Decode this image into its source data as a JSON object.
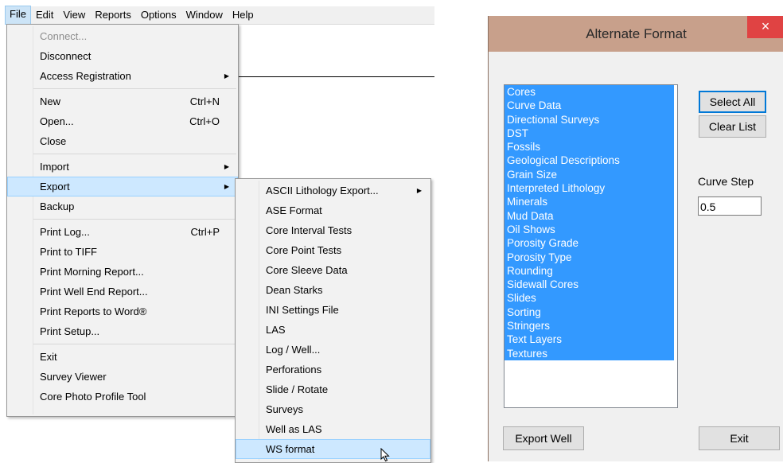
{
  "menubar": {
    "items": [
      "File",
      "Edit",
      "View",
      "Reports",
      "Options",
      "Window",
      "Help"
    ]
  },
  "file_menu": {
    "items": [
      {
        "label": "Connect...",
        "shortcut": "",
        "disabled": true
      },
      {
        "label": "Disconnect",
        "shortcut": ""
      },
      {
        "label": "Access Registration",
        "shortcut": "",
        "submenu": true
      },
      {
        "label": "New",
        "shortcut": "Ctrl+N"
      },
      {
        "label": "Open...",
        "shortcut": "Ctrl+O"
      },
      {
        "label": "Close",
        "shortcut": ""
      },
      {
        "label": "Import",
        "shortcut": "",
        "submenu": true
      },
      {
        "label": "Export",
        "shortcut": "",
        "submenu": true
      },
      {
        "label": "Backup",
        "shortcut": ""
      },
      {
        "label": "Print Log...",
        "shortcut": "Ctrl+P"
      },
      {
        "label": "Print to TIFF",
        "shortcut": ""
      },
      {
        "label": "Print Morning Report...",
        "shortcut": ""
      },
      {
        "label": "Print Well End Report...",
        "shortcut": ""
      },
      {
        "label": "Print Reports to Word®",
        "shortcut": ""
      },
      {
        "label": "Print Setup...",
        "shortcut": ""
      },
      {
        "label": "Exit",
        "shortcut": ""
      },
      {
        "label": "Survey Viewer",
        "shortcut": ""
      },
      {
        "label": "Core Photo Profile Tool",
        "shortcut": ""
      }
    ]
  },
  "export_menu": {
    "items": [
      "ASCII Lithology Export...",
      "ASE Format",
      "Core Interval Tests",
      "Core Point Tests",
      "Core Sleeve Data",
      "Dean Starks",
      "INI Settings File",
      "LAS",
      "Log / Well...",
      "Perforations",
      "Slide / Rotate",
      "Surveys",
      "Well as LAS",
      "WS format"
    ]
  },
  "dialog": {
    "title": "Alternate Format",
    "close": "×",
    "list_items": [
      "Cores",
      "Curve Data",
      "Directional Surveys",
      "DST",
      "Fossils",
      "Geological Descriptions",
      "Grain Size",
      "Interpreted Lithology",
      "Minerals",
      "Mud Data",
      "Oil Shows",
      "Porosity Grade",
      "Porosity Type",
      "Rounding",
      "Sidewall Cores",
      "Slides",
      "Sorting",
      "Stringers",
      "Text Layers",
      "Textures"
    ],
    "select_all": "Select All",
    "clear_list": "Clear List",
    "curve_step_label": "Curve Step",
    "curve_step_value": "0.5",
    "export_well": "Export Well",
    "exit": "Exit"
  }
}
